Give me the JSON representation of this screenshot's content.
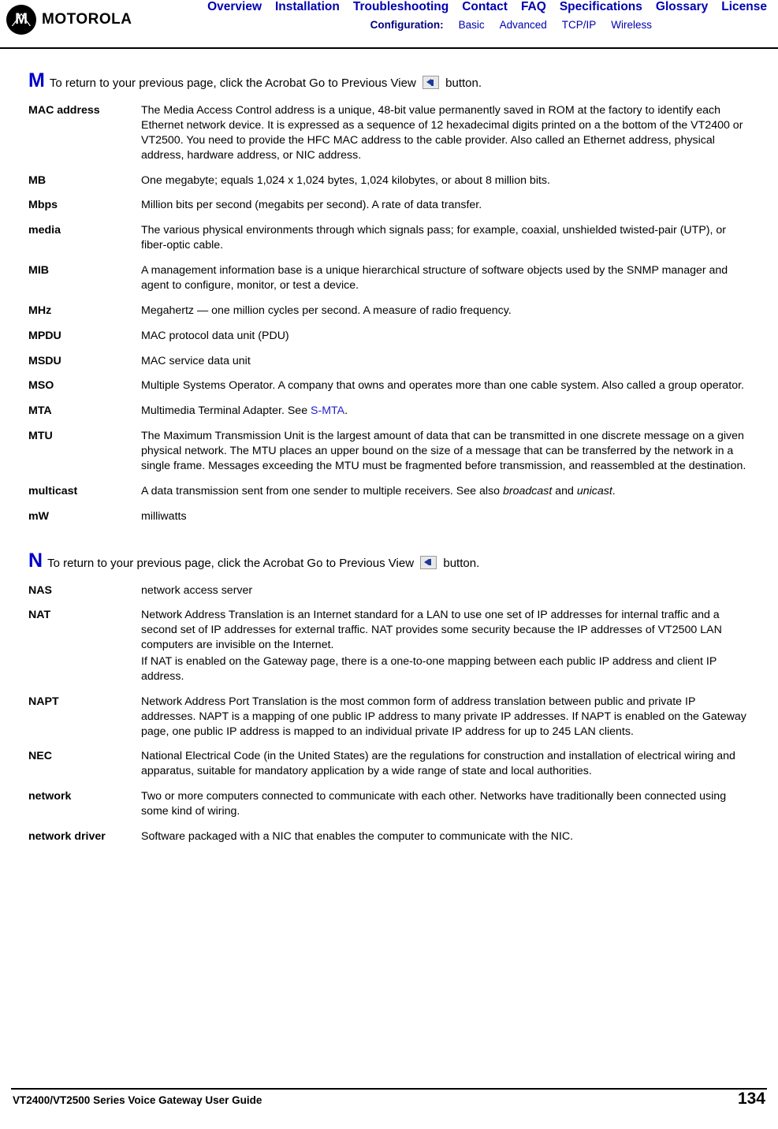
{
  "header": {
    "logo_letter": "M",
    "logo_text": "MOTOROLA",
    "nav": [
      {
        "label": "Overview"
      },
      {
        "label": "Installation"
      },
      {
        "label": "Troubleshooting"
      },
      {
        "label": "Contact"
      },
      {
        "label": "FAQ"
      },
      {
        "label": "Specifications"
      },
      {
        "label": "Glossary"
      },
      {
        "label": "License"
      }
    ],
    "subnav_label": "Configuration:",
    "subnav": [
      {
        "label": "Basic"
      },
      {
        "label": "Advanced"
      },
      {
        "label": "TCP/IP"
      },
      {
        "label": "Wireless"
      }
    ],
    "nav_color": "#0000b0"
  },
  "sections": [
    {
      "letter": "M",
      "instruction_before": "To return to your previous page, click the Acrobat Go to Previous View",
      "instruction_after": "button.",
      "icon": "go-to-previous-view-icon",
      "entries": [
        {
          "term": "MAC address",
          "paragraphs": [
            "The Media Access Control address is a unique, 48-bit value permanently saved in ROM at the factory to identify each Ethernet network device. It is expressed as a sequence of 12 hexadecimal digits printed on a the bottom of the VT2400 or VT2500. You need to provide the HFC MAC address to the cable provider. Also called an Ethernet address, physical address, hardware address, or NIC address."
          ]
        },
        {
          "term": "MB",
          "paragraphs": [
            "One megabyte; equals 1,024 x 1,024 bytes, 1,024 kilobytes, or about 8 million bits."
          ]
        },
        {
          "term": "Mbps",
          "paragraphs": [
            "Million bits per second (megabits per second). A rate of data transfer."
          ]
        },
        {
          "term": "media",
          "paragraphs": [
            "The various physical environments through which signals pass; for example, coaxial, unshielded twisted-pair (UTP), or fiber-optic cable."
          ]
        },
        {
          "term": "MIB",
          "paragraphs": [
            "A management information base is a unique hierarchical structure of software objects used by the SNMP manager and agent to configure, monitor, or test a device."
          ]
        },
        {
          "term": "MHz",
          "paragraphs": [
            "Megahertz — one million cycles per second. A measure of radio frequency."
          ]
        },
        {
          "term": "MPDU",
          "paragraphs": [
            "MAC protocol data unit (PDU)"
          ]
        },
        {
          "term": "MSDU",
          "paragraphs": [
            "MAC service data unit"
          ]
        },
        {
          "term": "MSO",
          "paragraphs": [
            "Multiple Systems Operator. A company that owns and operates more than one cable system. Also called a group operator."
          ]
        },
        {
          "term": "MTA",
          "paragraphs": [
            "Multimedia Terminal Adapter. See "
          ],
          "link_text": "S-MTA",
          "trail_text": "."
        },
        {
          "term": "MTU",
          "paragraphs": [
            "The Maximum Transmission Unit is the largest amount of data that can be transmitted in one discrete message on a given physical network. The MTU places an upper bound on the size of a message that can be transferred by the network in a single frame. Messages exceeding the MTU must be fragmented before transmission, and reassembled at the destination."
          ]
        },
        {
          "term": "multicast",
          "paragraphs": [
            "A data transmission sent from one sender to multiple receivers. See also "
          ],
          "italic_1": "broadcast",
          "mid_text": " and ",
          "italic_2": "unicast",
          "trail_text": "."
        },
        {
          "term": "mW",
          "paragraphs": [
            "milliwatts"
          ]
        }
      ]
    },
    {
      "letter": "N",
      "instruction_before": "To return to your previous page, click the Acrobat Go to Previous View",
      "instruction_after": "button.",
      "icon": "go-to-previous-view-icon",
      "entries": [
        {
          "term": "NAS",
          "paragraphs": [
            "network access server"
          ]
        },
        {
          "term": "NAT",
          "paragraphs": [
            "Network Address Translation is an Internet standard for a LAN to use one set of IP addresses for internal traffic and a second set of IP addresses for external traffic. NAT provides some security because the IP addresses of VT2500 LAN computers are invisible on the Internet.",
            "If NAT is enabled on the Gateway page, there is a one-to-one mapping between each public IP address and client IP address."
          ]
        },
        {
          "term": "NAPT",
          "paragraphs": [
            "Network Address Port Translation is the most common form of address translation between public and private IP addresses. NAPT is a mapping of one public IP address to many private IP addresses. If NAPT is enabled on the Gateway page, one public IP address is mapped to an individual private IP address for up to 245 LAN clients."
          ]
        },
        {
          "term": "NEC",
          "paragraphs": [
            "National Electrical Code (in the United States) are the regulations for construction and installation of electrical wiring and apparatus, suitable for mandatory application by a wide range of state and local authorities."
          ]
        },
        {
          "term": "network",
          "paragraphs": [
            "Two or more computers connected to communicate with each other. Networks have traditionally been connected using some kind of wiring."
          ]
        },
        {
          "term": "network driver",
          "paragraphs": [
            "Software packaged with a NIC that enables the computer to communicate with the NIC."
          ]
        }
      ]
    }
  ],
  "footer": {
    "title": "VT2400/VT2500 Series Voice Gateway User Guide",
    "page_number": "134"
  }
}
